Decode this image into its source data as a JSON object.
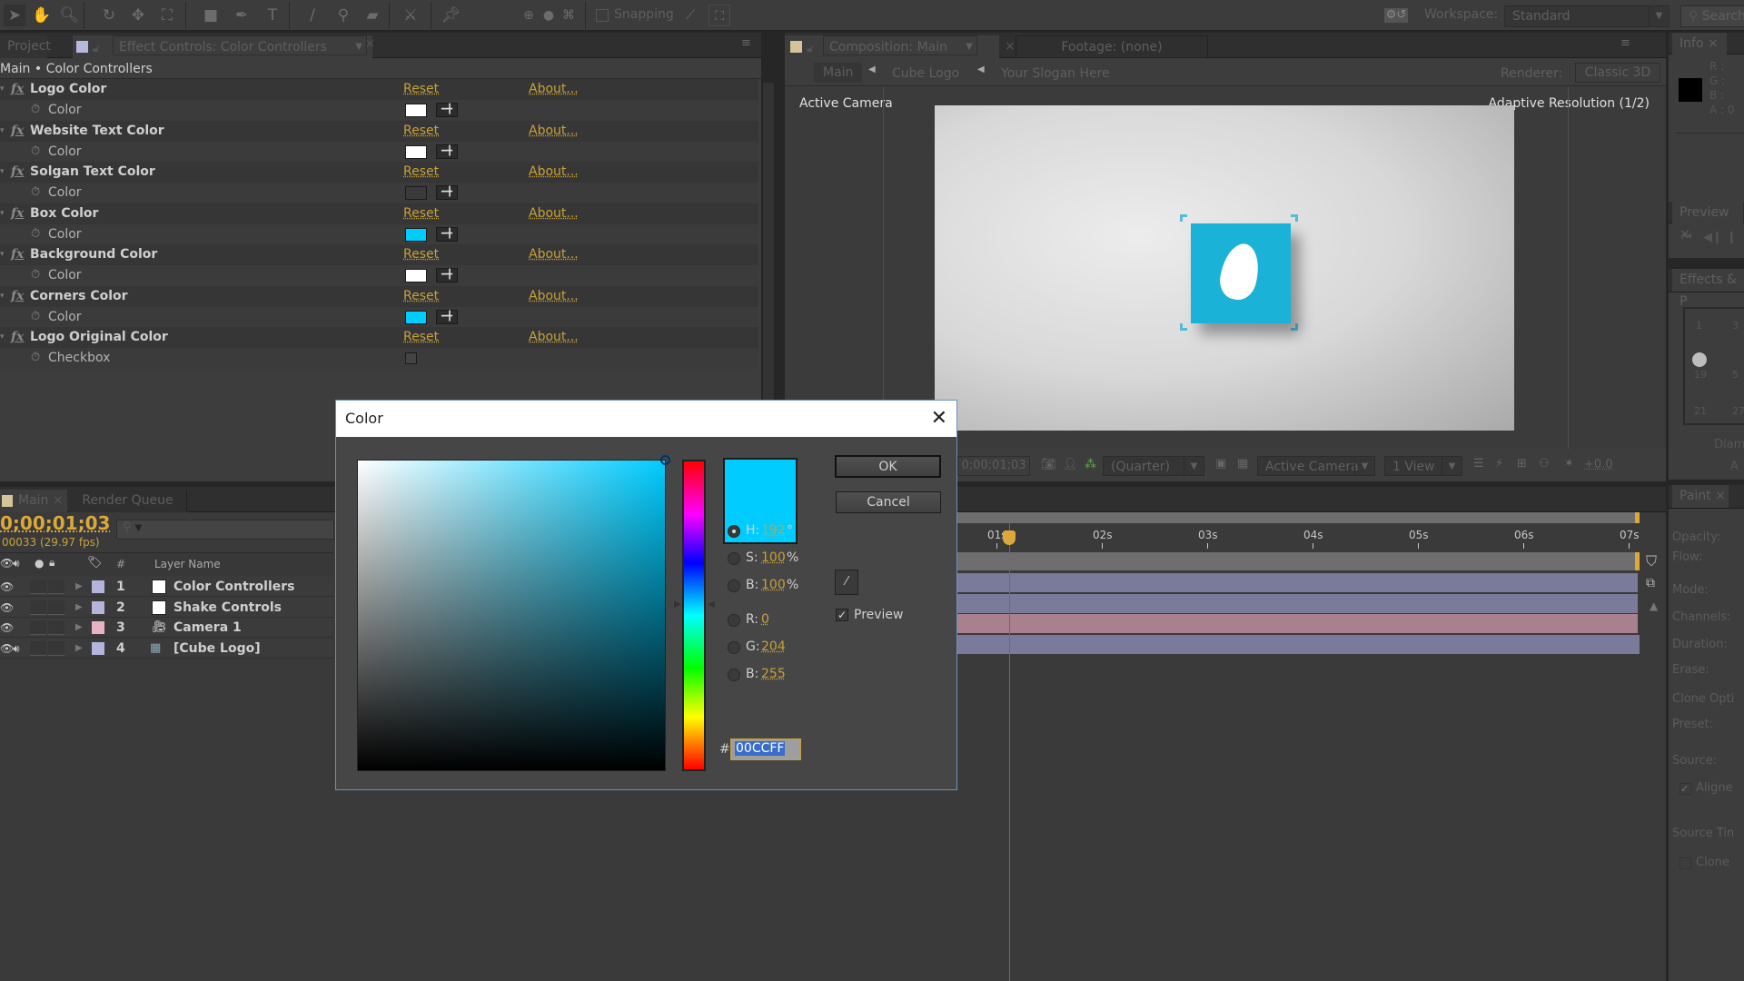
{
  "toolbar": {
    "tools": [
      "selection-tool",
      "hand-tool",
      "zoom-tool",
      "rotate-tool",
      "orbit-camera-tool",
      "pan-behind-tool",
      "rectangle-tool",
      "pen-tool",
      "type-tool",
      "brush-tool",
      "clone-stamp-tool",
      "eraser-tool",
      "roto-brush-tool",
      "puppet-pin-tool"
    ],
    "snapping_label": "Snapping",
    "workspace_label": "Workspace:",
    "workspace_value": "Standard",
    "search_placeholder": "Search"
  },
  "project_panel": {
    "tab_label": "Project"
  },
  "effect_controls": {
    "tab_label": "Effect Controls: Color Controllers",
    "breadcrumb": "Main • Color Controllers",
    "reset_label": "Reset",
    "about_label": "About...",
    "effects": [
      {
        "name": "Logo Color",
        "property": "Color",
        "type": "color",
        "value": "#ffffff"
      },
      {
        "name": "Website Text Color",
        "property": "Color",
        "type": "color",
        "value": "#ffffff"
      },
      {
        "name": "Solgan Text Color",
        "property": "Color",
        "type": "color",
        "value": "#3a3a3a"
      },
      {
        "name": "Box Color",
        "property": "Color",
        "type": "color",
        "value": "#00ccff"
      },
      {
        "name": "Background Color",
        "property": "Color",
        "type": "color",
        "value": "#ffffff"
      },
      {
        "name": "Corners Color",
        "property": "Color",
        "type": "color",
        "value": "#00ccff"
      },
      {
        "name": "Logo Original Color",
        "property": "Checkbox",
        "type": "checkbox",
        "value": false
      }
    ]
  },
  "composition": {
    "tab_label": "Composition: Main",
    "footage_tab_label": "Footage: (none)",
    "nav": [
      "Main",
      "Cube Logo",
      "Your Slogan Here"
    ],
    "renderer_label": "Renderer:",
    "renderer_value": "Classic 3D",
    "camera_label": "Active Camera",
    "resolution_label": "Adaptive Resolution (1/2)",
    "logo_color": "#1ab2d6",
    "footer": {
      "timecode": "0;00;01;03",
      "resolution": "(Quarter)",
      "camera": "Active Camera",
      "views": "1 View",
      "exposure": "+0.0"
    }
  },
  "color_dialog": {
    "title": "Color",
    "ok_label": "OK",
    "cancel_label": "Cancel",
    "preview_label": "Preview",
    "preview_checked": true,
    "hue_fraction": 0.533,
    "fields": {
      "h": {
        "label": "H:",
        "value": "192",
        "unit": "°"
      },
      "s": {
        "label": "S:",
        "value": "100",
        "unit": "%"
      },
      "b": {
        "label": "B:",
        "value": "100",
        "unit": "%"
      },
      "r": {
        "label": "R:",
        "value": "0"
      },
      "g": {
        "label": "G:",
        "value": "204"
      },
      "bl": {
        "label": "B:",
        "value": "255"
      }
    },
    "hex_prefix": "#",
    "hex_value": "00CCFF",
    "selected_color": "#00ccff"
  },
  "timeline": {
    "tab_label": "Main",
    "render_queue_label": "Render Queue",
    "timecode": "0;00;01;03",
    "frame_info": "00033 (29.97 fps)",
    "columns": {
      "number": "#",
      "layer_name": "Layer Name"
    },
    "layers": [
      {
        "index": "1",
        "name": "Color Controllers",
        "label_color": "#b4b4dc",
        "bar_color": "#7a7a9a"
      },
      {
        "index": "2",
        "name": "Shake Controls",
        "label_color": "#b4b4dc",
        "bar_color": "#7a7a9a"
      },
      {
        "index": "3",
        "name": "Camera 1",
        "label_color": "#e6b4c3",
        "bar_color": "#a8808e"
      },
      {
        "index": "4",
        "name": "[Cube Logo]",
        "label_color": "#b4b4dc",
        "bar_color": "#7a7a9a"
      }
    ],
    "ruler": [
      "01s",
      "02s",
      "03s",
      "04s",
      "05s",
      "06s",
      "07s"
    ]
  },
  "info_panel": {
    "tab_label": "Info",
    "r": "R :",
    "g": "G :",
    "b": "B :",
    "a": "A : 0"
  },
  "preview_panel": {
    "tab_label": "Preview"
  },
  "effects_presets_panel": {
    "tab_label": "Effects & P",
    "brush_sizes": [
      "1",
      "3",
      "19",
      "5",
      "21",
      "27"
    ],
    "diameter_label": "Diam",
    "angle_label": "A"
  },
  "paint_panel": {
    "tab_label": "Paint",
    "labels": [
      "Opacity:",
      "Flow:",
      "Mode:",
      "Channels:",
      "Duration:",
      "Erase:",
      "Clone Opti",
      "Preset:",
      "Source:",
      "Aligne",
      "Source Tin",
      "Clone"
    ]
  }
}
